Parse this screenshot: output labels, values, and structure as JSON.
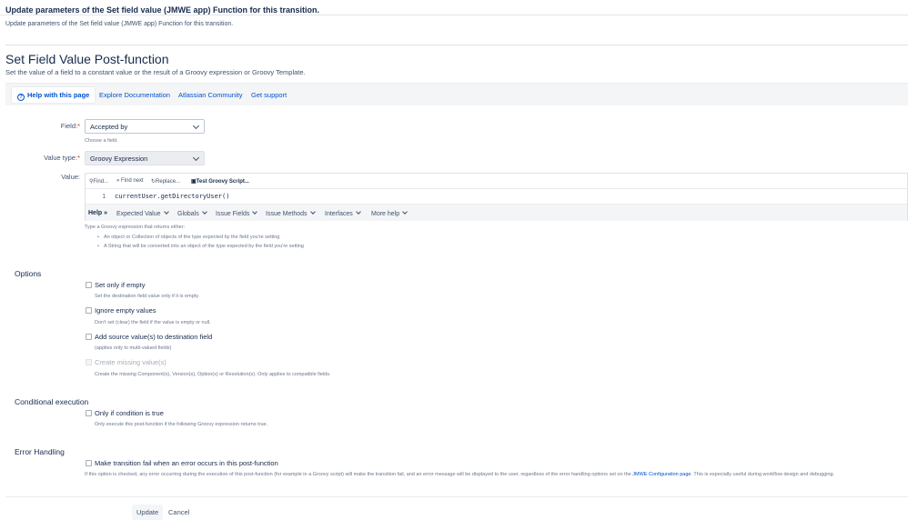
{
  "header": {
    "title": "Update parameters of the Set field value (JMWE app) Function for this transition.",
    "subtitle": "Update parameters of the Set field value (JMWE app) Function for this transition."
  },
  "postfunction": {
    "title": "Set Field Value Post-function",
    "description": "Set the value of a field to a constant value or the result of a Groovy expression or Groovy Template."
  },
  "helpbar": {
    "help_page": "Help with this page",
    "explore": "Explore Documentation",
    "community": "Atlassian Community",
    "support": "Get support"
  },
  "form": {
    "field_label": "Field:",
    "field_value": "Accepted by",
    "field_hint": "Choose a field.",
    "value_type_label": "Value type:",
    "value_type_value": "Groovy Expression",
    "value_label": "Value:",
    "required_mark": "*"
  },
  "editor": {
    "toolbar": {
      "find": "Find...",
      "find_next": "Find next",
      "replace": "Replace...",
      "test": "Test Groovy Script..."
    },
    "line_number": "1",
    "code": "currentUser.getDirectoryUser()",
    "help_menu": {
      "help": "Help",
      "arrows": "»",
      "expected_value": "Expected Value",
      "globals": "Globals",
      "issue_fields": "Issue Fields",
      "issue_methods": "Issue Methods",
      "interfaces": "Interfaces",
      "more_help": "More help"
    },
    "hint": "Type a Groovy expression that returns either:",
    "bullets": [
      "An object or Collection of objects of the type expected by the field you're setting",
      "A String that will be converted into an object of the type expected by the field you're setting"
    ]
  },
  "options": {
    "title": "Options",
    "items": [
      {
        "label": "Set only if empty",
        "hint": "Set the destination field value only if it is empty."
      },
      {
        "label": "Ignore empty values",
        "hint": "Don't set (clear) the field if the value is empty or null."
      },
      {
        "label": "Add source value(s) to destination field",
        "hint": "(applies only to multi-valued fields)"
      },
      {
        "label": "Create missing value(s)",
        "hint": "Create the missing Component(s), Version(s), Option(s) or Resolution(s). Only applies to compatible fields."
      }
    ]
  },
  "conditional": {
    "title": "Conditional execution",
    "label": "Only if condition is true",
    "hint": "Only execute this post-function if the following Groovy expression returns true."
  },
  "error_handling": {
    "title": "Error Handling",
    "label": "Make transition fail when an error occurs in this post-function",
    "hint_pre": "If this option is checked, any error occurring during the execution of this post-function (for example in a Groovy script) will make the transition fail, and an error message will be displayed to the user, regardless of the error handling options set on the",
    "hint_link": "JMWE Configuration page",
    "hint_post": ". This is especially useful during workflow design and debugging."
  },
  "actions": {
    "update": "Update",
    "cancel": "Cancel"
  }
}
